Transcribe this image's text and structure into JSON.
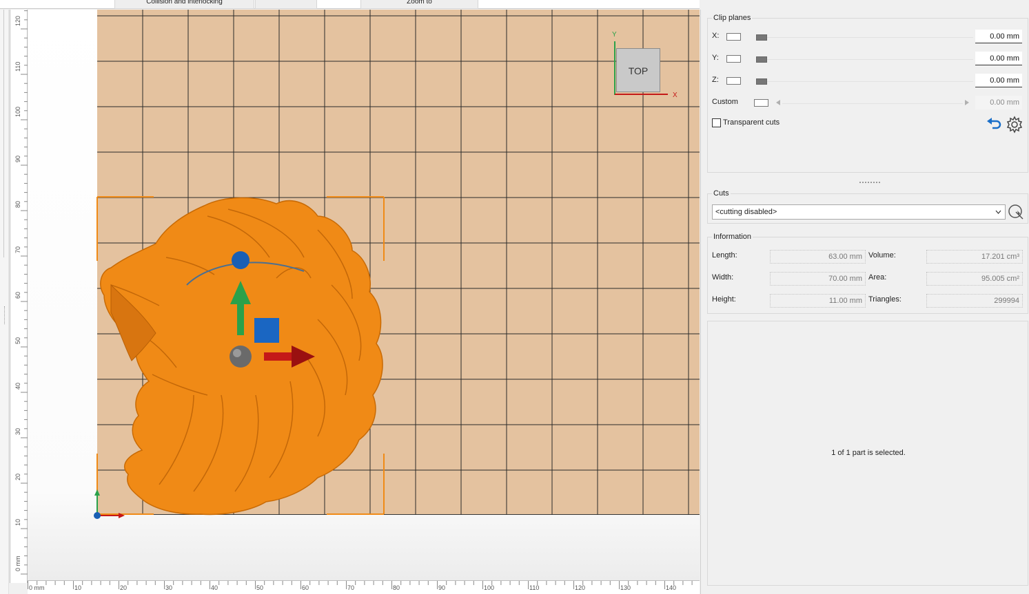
{
  "tabs": [
    "Collision and interlocking",
    "",
    "Zoom to"
  ],
  "rulers": {
    "vertical_labels": [
      "120",
      "110",
      "100",
      "90",
      "80",
      "70",
      "60",
      "50",
      "40",
      "30",
      "20",
      "10",
      "0 mm"
    ],
    "horizontal_labels": [
      "0 mm",
      "10",
      "20",
      "30",
      "40",
      "50",
      "60",
      "70",
      "80",
      "90",
      "100",
      "110",
      "120",
      "130",
      "140"
    ]
  },
  "viewport": {
    "nav_cube_label": "TOP",
    "axis_y": "Y",
    "axis_x": "X",
    "model": "lion-head-relief",
    "colors": {
      "bed": "#e4c29f",
      "model": "#f08a16",
      "selection": "#f08a16"
    }
  },
  "clip_planes": {
    "title": "Clip planes",
    "rows": [
      {
        "label": "X:",
        "value": "0.00 mm"
      },
      {
        "label": "Y:",
        "value": "0.00 mm"
      },
      {
        "label": "Z:",
        "value": "0.00 mm"
      },
      {
        "label": "Custom",
        "value": "0.00 mm"
      }
    ],
    "transparent_cuts_label": "Transparent cuts"
  },
  "cuts": {
    "title": "Cuts",
    "selected": "<cutting disabled>"
  },
  "information": {
    "title": "Information",
    "length_label": "Length:",
    "length": "63.00 mm",
    "width_label": "Width:",
    "width": "70.00 mm",
    "height_label": "Height:",
    "height": "11.00 mm",
    "volume_label": "Volume:",
    "volume": "17.201 cm³",
    "area_label": "Area:",
    "area": "95.005 cm²",
    "triangles_label": "Triangles:",
    "triangles": "299994"
  },
  "status": "1 of 1 part is selected."
}
